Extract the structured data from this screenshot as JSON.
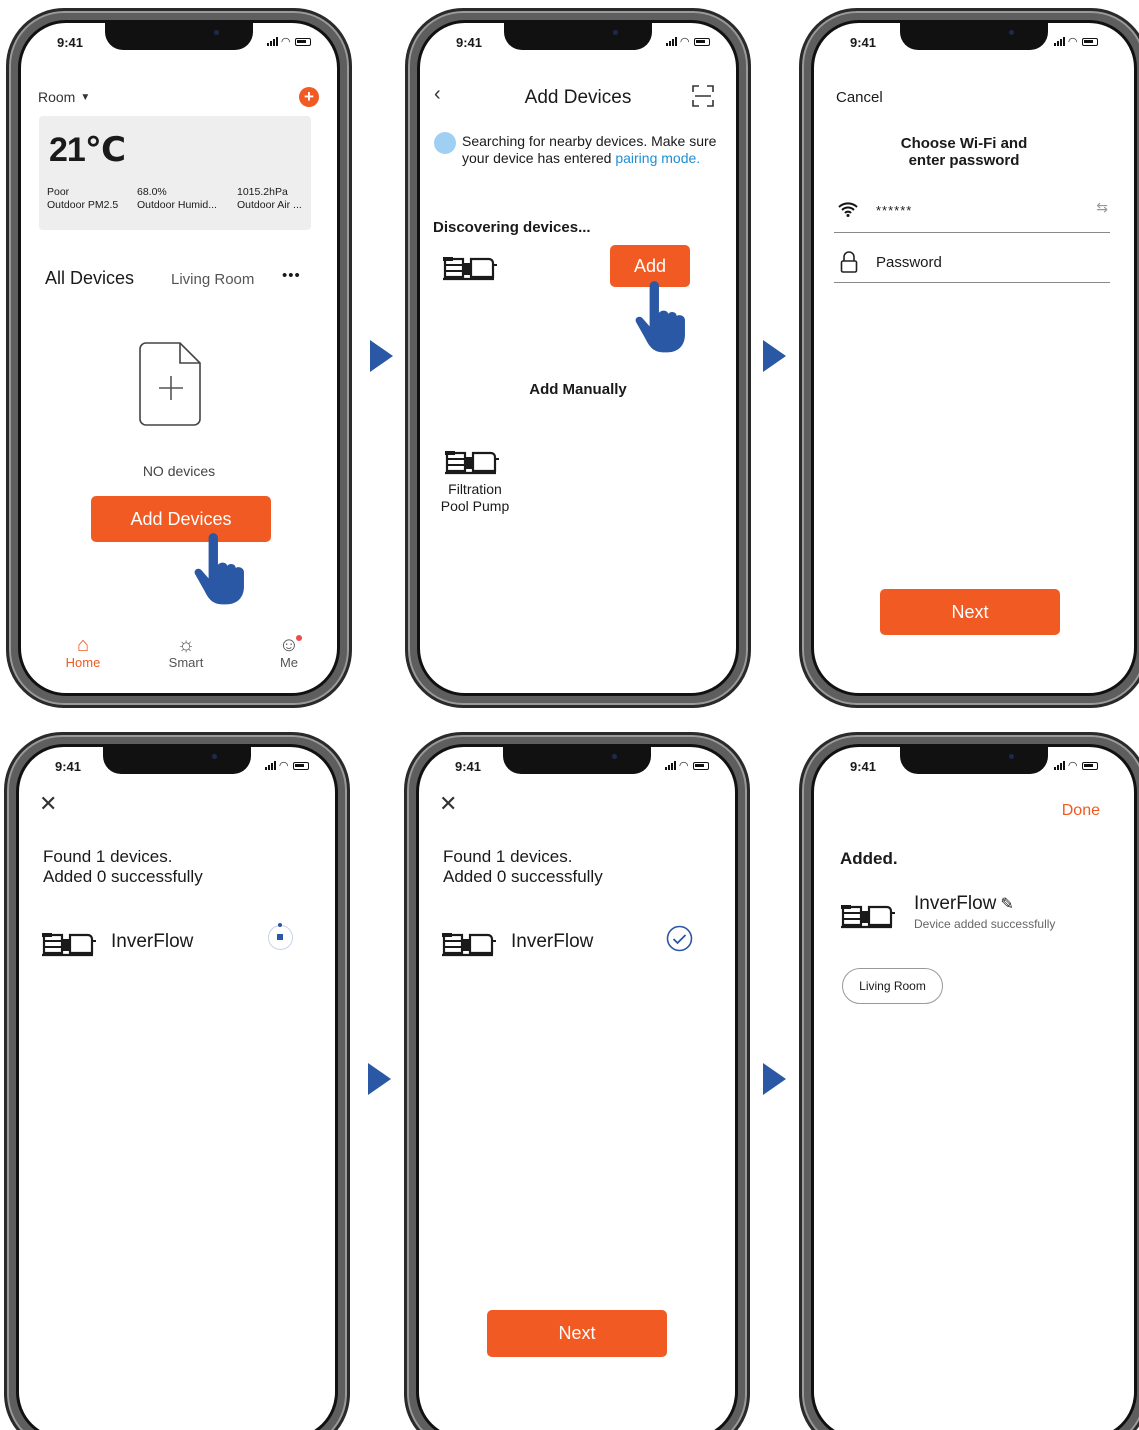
{
  "status": {
    "time": "9:41"
  },
  "colors": {
    "accent": "#f15a22",
    "link": "#1e8fd6",
    "hand": "#2a58a5"
  },
  "screen1": {
    "room_label": "Room",
    "temperature": "21℃",
    "weather": [
      {
        "value": "Poor",
        "label": "Outdoor PM2.5"
      },
      {
        "value": "68.0%",
        "label": "Outdoor Humid..."
      },
      {
        "value": "1015.2hPa",
        "label": "Outdoor Air ..."
      }
    ],
    "tabs": [
      "All Devices",
      "Living Room"
    ],
    "more": "•••",
    "empty_text": "NO devices",
    "add_button": "Add Devices",
    "nav": [
      "Home",
      "Smart",
      "Me"
    ]
  },
  "screen2": {
    "title": "Add Devices",
    "searching_text": "Searching for nearby devices. Make sure your device has entered",
    "pairing_link": "pairing mode.",
    "discovering": "Discovering devices...",
    "add_button": "Add",
    "add_manually": "Add Manually",
    "device_name_line1": "Filtration",
    "device_name_line2": "Pool Pump"
  },
  "screen3": {
    "cancel": "Cancel",
    "heading_line1": "Choose Wi-Fi and",
    "heading_line2": "enter password",
    "wifi_value": "******",
    "password_placeholder": "Password",
    "next": "Next"
  },
  "screen4": {
    "found_line1": "Found 1 devices.",
    "found_line2": "Added 0 successfully",
    "device": "InverFlow"
  },
  "screen5": {
    "found_line1": "Found 1 devices.",
    "found_line2": "Added 0 successfully",
    "device": "InverFlow",
    "next": "Next"
  },
  "screen6": {
    "done": "Done",
    "added": "Added.",
    "device": "InverFlow",
    "device_sub": "Device added successfully",
    "room_chip": "Living Room"
  }
}
